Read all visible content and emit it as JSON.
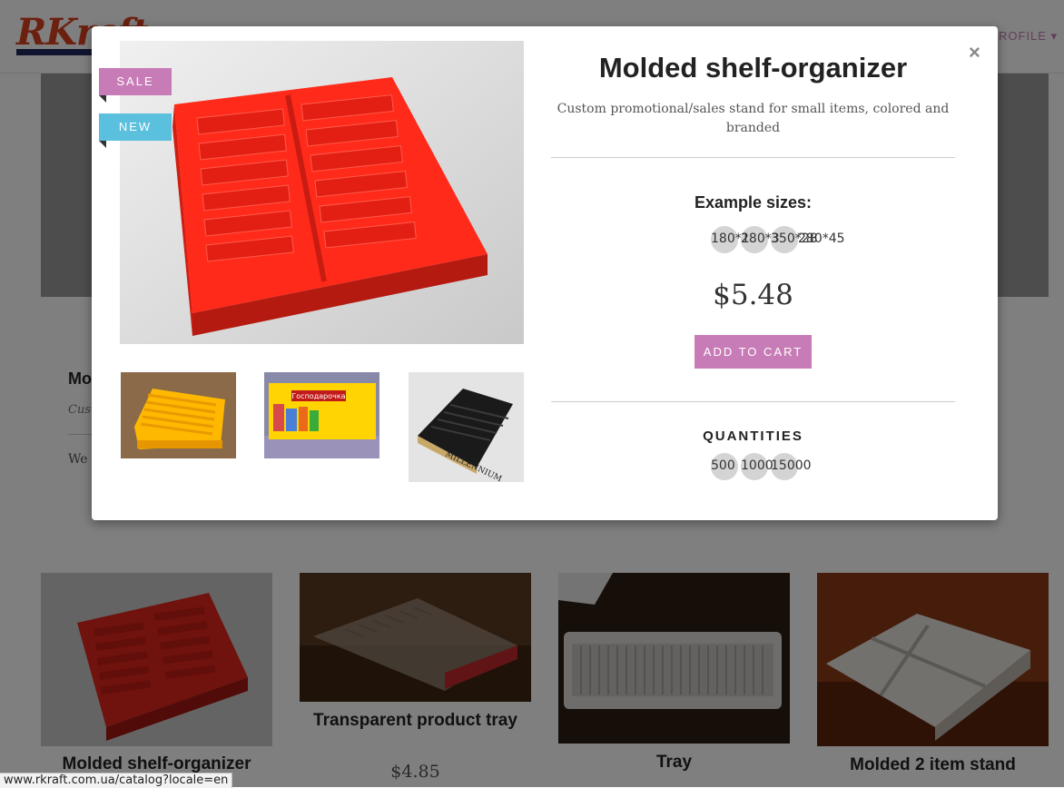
{
  "site": {
    "logo": "RKraft",
    "nav_profile": "ROFILE ▾"
  },
  "background_page": {
    "product_title": "Mo",
    "product_sub": "Cust",
    "product_text": "We"
  },
  "cards": [
    {
      "name": "Molded shelf-organizer",
      "price": ""
    },
    {
      "name": "Transparent product tray",
      "price": "$4.85"
    },
    {
      "name": "Tray",
      "price": ""
    },
    {
      "name": "Molded 2 item stand",
      "price": ""
    }
  ],
  "modal": {
    "close": "×",
    "badges": {
      "sale": "SALE",
      "new": "NEW"
    },
    "title": "Molded shelf-organizer",
    "description": "Custom promotional/sales stand for small items, colored and branded",
    "sizes_heading": "Example sizes:",
    "sizes": [
      "180*1",
      "280*3",
      "350*28",
      "280*45"
    ],
    "price": "$5.48",
    "add_to_cart": "ADD TO CART",
    "quantities_heading": "QUANTITIES",
    "quantities": [
      "500",
      "1000",
      "15000"
    ],
    "thumb_labels": {
      "thumb2": "Господарочка",
      "thumb3": "MILLENNIUM"
    }
  },
  "status_url": "www.rkraft.com.ua/catalog?locale=en",
  "colors": {
    "accent": "#c87cb7",
    "new_badge": "#5bc0de",
    "logo": "#d9401e"
  }
}
